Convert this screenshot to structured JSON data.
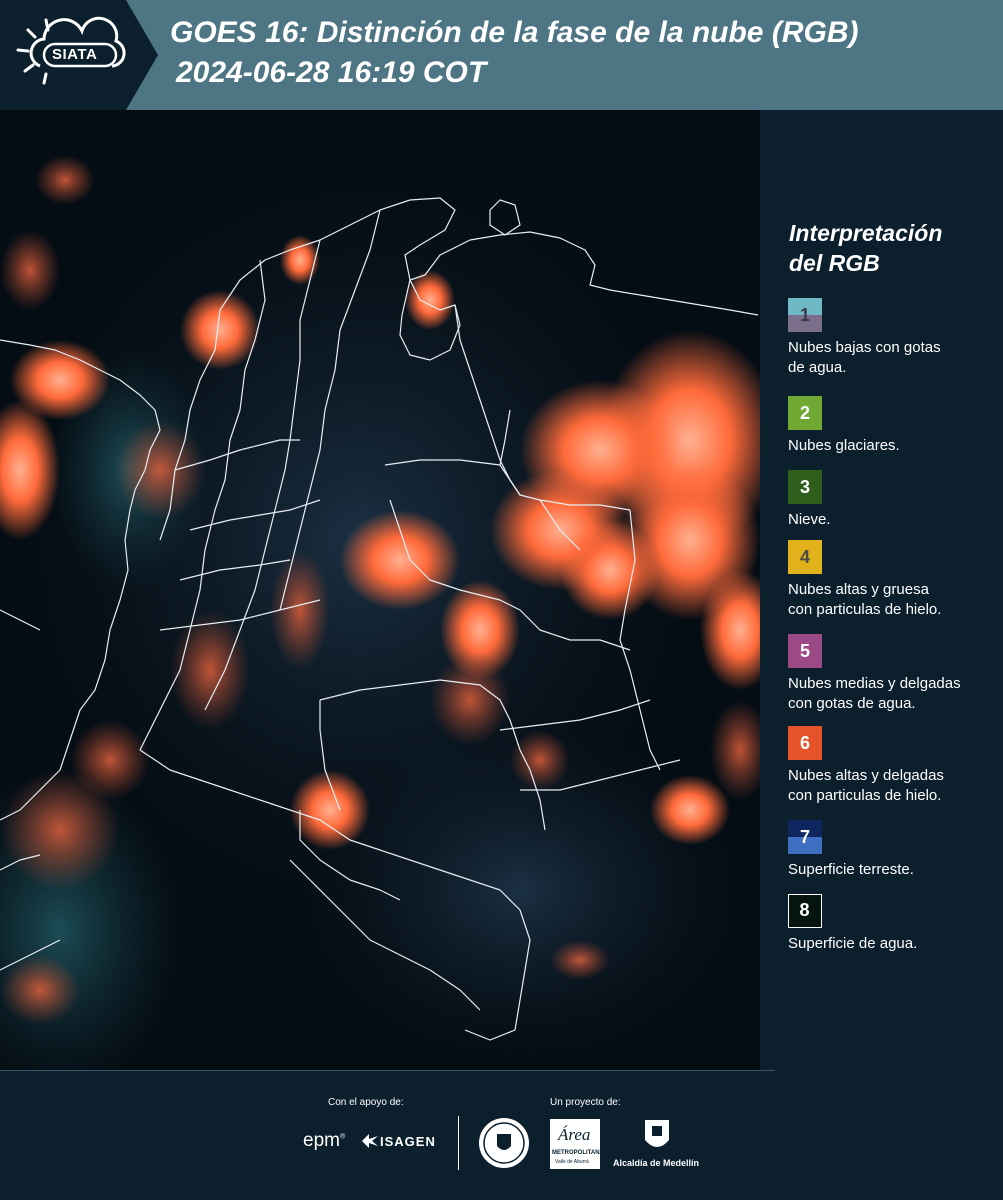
{
  "header": {
    "logo_text": "SIATA",
    "title": "GOES 16: Distinción de la fase de la nube (RGB)",
    "datetime": "2024-06-28 16:19 COT"
  },
  "legend": {
    "title_line1": "Interpretación",
    "title_line2": "del RGB",
    "items": [
      {
        "number": "1",
        "label_line1": "Nubes bajas con gotas",
        "label_line2": "de agua.",
        "color_top": "#6fb8c6",
        "color_bottom": "#7a6e8a"
      },
      {
        "number": "2",
        "label_line1": "Nubes glaciares.",
        "label_line2": "",
        "color_top": "#6fa832",
        "color_bottom": "#6fa832"
      },
      {
        "number": "3",
        "label_line1": "Nieve.",
        "label_line2": "",
        "color_top": "#2f5e1c",
        "color_bottom": "#2f5e1c"
      },
      {
        "number": "4",
        "label_line1": "Nubes altas y gruesa",
        "label_line2": "con particulas de hielo.",
        "color_top": "#e2b21c",
        "color_bottom": "#e2b21c"
      },
      {
        "number": "5",
        "label_line1": "Nubes medias y delgadas",
        "label_line2": "con gotas de agua.",
        "color_top": "#9c4a86",
        "color_bottom": "#9c4a86"
      },
      {
        "number": "6",
        "label_line1": "Nubes altas y delgadas",
        "label_line2": "con particulas de hielo.",
        "color_top": "#e6522a",
        "color_bottom": "#e6522a"
      },
      {
        "number": "7",
        "label_line1": "Superficie terreste.",
        "label_line2": "",
        "color_top": "#0f2560",
        "color_bottom": "#3f6fc2"
      },
      {
        "number": "8",
        "label_line1": "Superficie de agua.",
        "label_line2": "",
        "color_top": "#06140e",
        "color_bottom": "#06140e"
      }
    ]
  },
  "footer": {
    "support_label": "Con el apoyo de:",
    "project_label": "Un proyecto de:",
    "sponsor1": "epm",
    "sponsor2": "ISAGEN",
    "partner1": "METROPOLITANA",
    "partner1_sub": "Valle de Aburrá",
    "partner2": "Alcaldía de Medellín"
  },
  "colors": {
    "header_bg": "#4e7583",
    "panel_bg": "#0b1f2d",
    "cloud_orange": "#ff6a3a"
  }
}
